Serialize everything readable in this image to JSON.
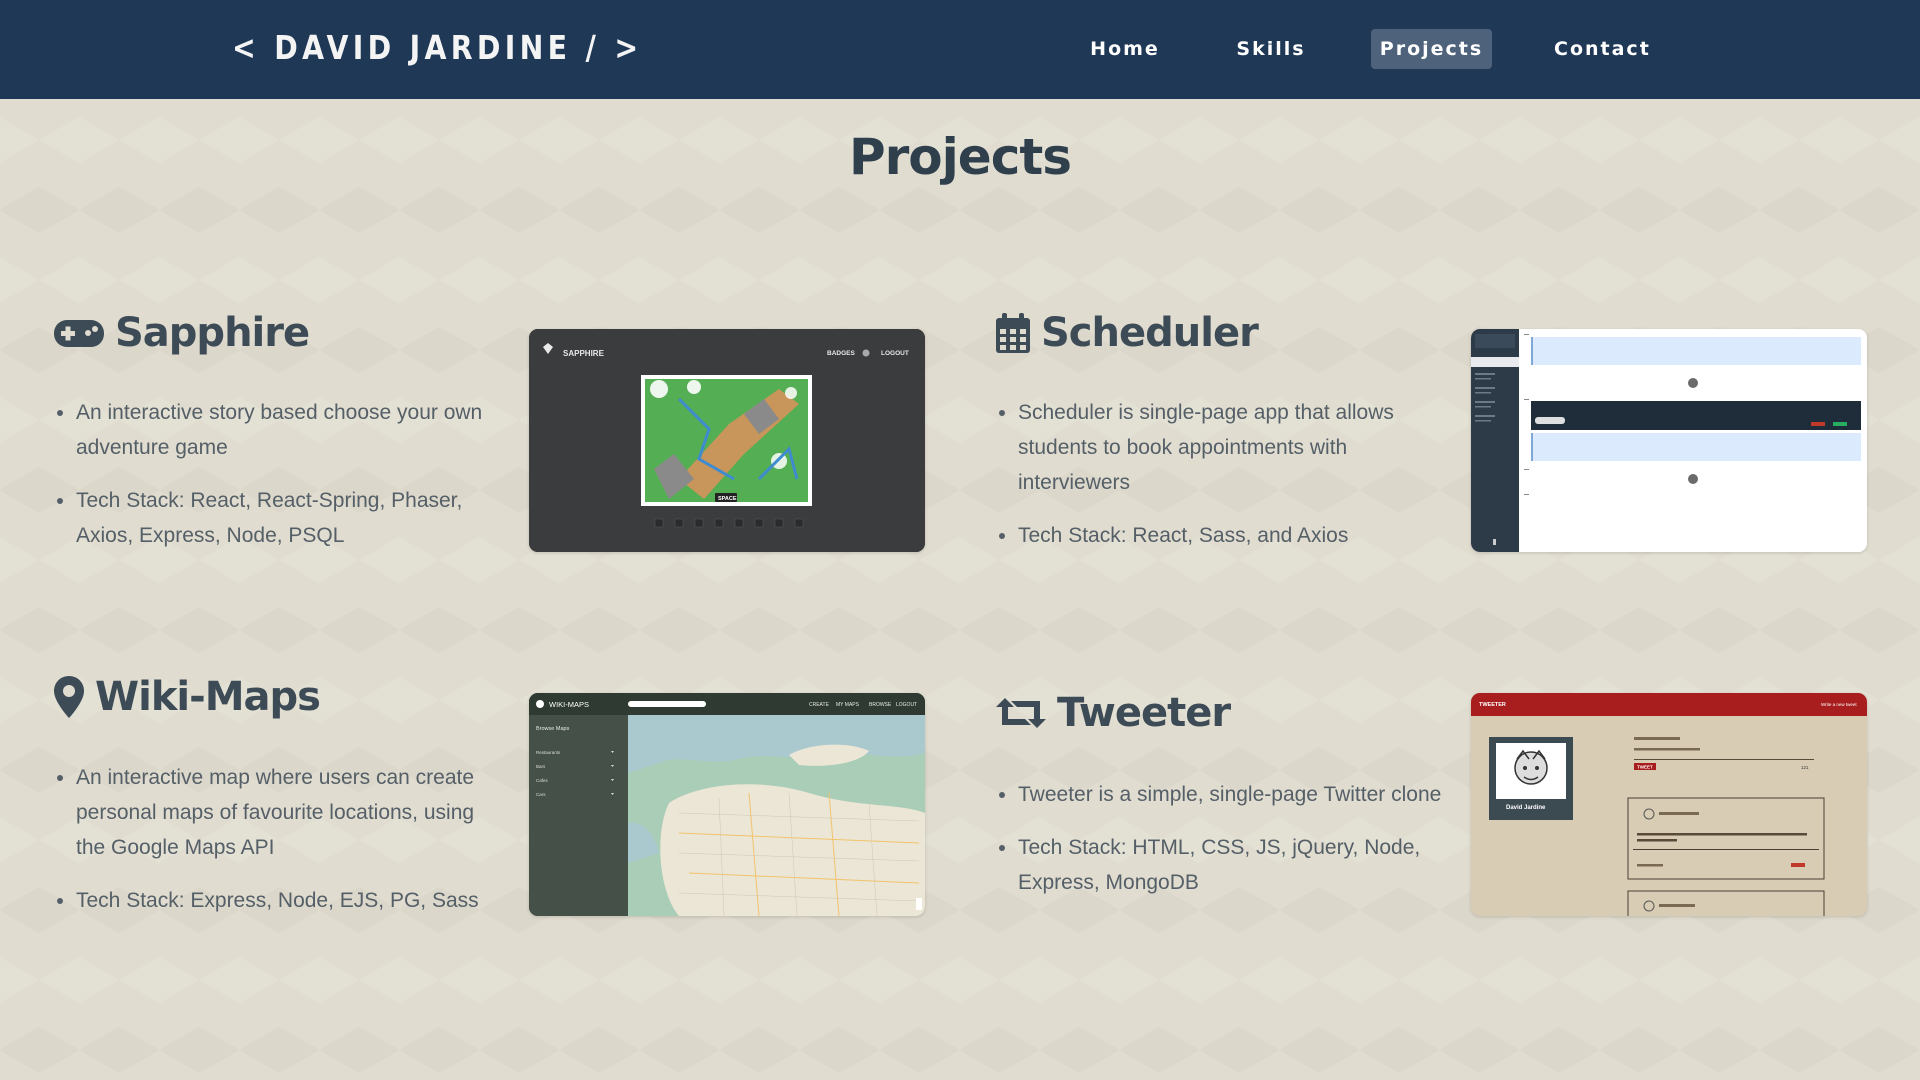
{
  "navbar": {
    "brand": "< DAVID JARDINE / >",
    "links": [
      "Home",
      "Skills",
      "Projects",
      "Contact"
    ],
    "active": "Projects"
  },
  "page": {
    "title": "Projects"
  },
  "projects": [
    {
      "name": "Sapphire",
      "icon": "gamepad-icon",
      "bullets": [
        "An interactive story based choose your own adventure game",
        "Tech Stack: React, React-Spring, Phaser, Axios, Express, Node, PSQL"
      ],
      "screenshot": {
        "app_title": "SAPPHIRE",
        "menu": [
          "BADGES",
          "LOGOUT"
        ],
        "button": "SPACE"
      }
    },
    {
      "name": "Scheduler",
      "icon": "calendar-icon",
      "bullets": [
        "Scheduler is single-page app that allows students to book appointments with interviewers",
        "Tech Stack: React, Sass, and Axios"
      ],
      "screenshot": {}
    },
    {
      "name": "Wiki-Maps",
      "icon": "map-marker-icon",
      "bullets": [
        "An interactive map where users can create personal maps of favourite locations, using the Google Maps API",
        "Tech Stack: Express, Node, EJS, PG, Sass"
      ],
      "screenshot": {
        "app_title": "WIKI-MAPS",
        "menu": [
          "CREATE",
          "MY MAPS",
          "BROWSE",
          "LOGOUT"
        ],
        "sidebar_title": "Browse Maps",
        "categories": [
          "Restaurants",
          "Bars",
          "Cafes",
          "Cars"
        ]
      }
    },
    {
      "name": "Tweeter",
      "icon": "retweet-icon",
      "bullets": [
        "Tweeter is a simple, single-page Twitter clone",
        "Tech Stack: HTML, CSS, JS, jQuery, Node, Express, MongoDB"
      ],
      "screenshot": {
        "app_title": "TWEETER",
        "write_label": "Write a new tweet",
        "profile_name": "David Jardine",
        "tweet_button": "TWEET",
        "char_count": "121"
      }
    }
  ],
  "colors": {
    "navbar": "#1f3856",
    "active_link": "#4f627b",
    "background": "#e0dccf",
    "heading": "#2f3f4c",
    "body_text": "#555f68"
  }
}
